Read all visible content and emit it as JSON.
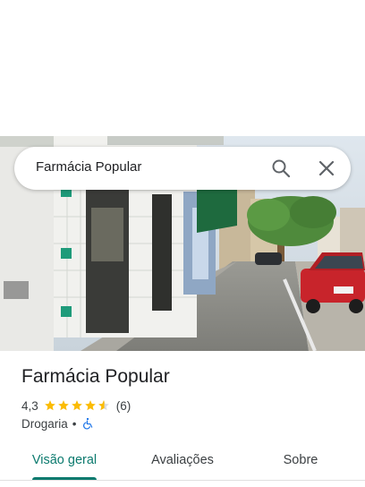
{
  "search": {
    "query": "Farmácia Popular",
    "search_icon": "search-icon",
    "close_icon": "close-icon"
  },
  "place": {
    "name": "Farmácia Popular",
    "rating": "4,3",
    "rating_value": 4.3,
    "review_count": "(6)",
    "category": "Drogaria",
    "separator": "•",
    "accessibility_icon": "wheelchair-icon"
  },
  "tabs": [
    {
      "label": "Visão geral",
      "active": true
    },
    {
      "label": "Avaliações",
      "active": false
    },
    {
      "label": "Sobre",
      "active": false
    }
  ],
  "colors": {
    "accent": "#0b7a6e",
    "star": "#fbbc04",
    "accessibility": "#1a73e8"
  }
}
